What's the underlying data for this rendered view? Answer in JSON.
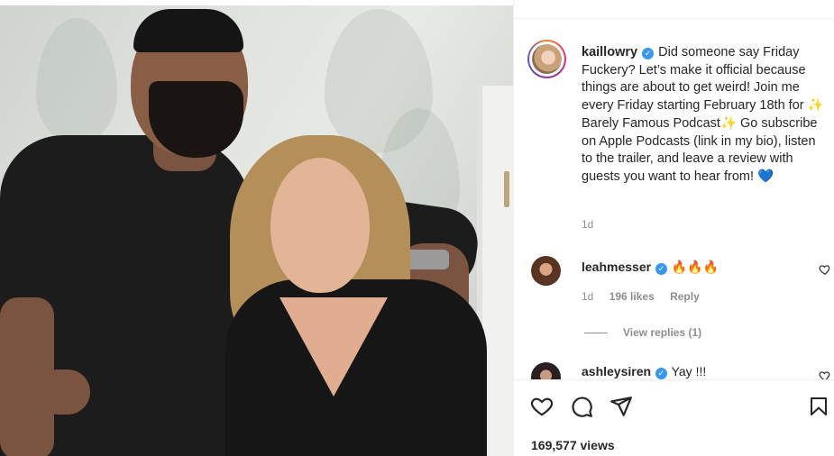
{
  "post": {
    "username": "kaillowry",
    "caption_p1": " Did someone say Friday Fuckery? Let’s make it official because things are about to get weird! Join me every Friday starting February 18th for ",
    "sparkle": "✨",
    "podcast": "Barely Famous Podcast",
    "caption_p2": " Go subscribe on Apple Podcasts (link in my bio), listen to the trailer, and leave a review with guests you want to hear from! ",
    "heart": "💙",
    "time": "1d",
    "views": "169,577 views"
  },
  "comments": [
    {
      "username": "leahmesser",
      "text": "🔥🔥🔥",
      "time": "1d",
      "likes": "196 likes",
      "reply": "Reply"
    },
    {
      "username": "ashleysiren",
      "text": "Yay !!!"
    }
  ],
  "view_replies": "View replies (1)",
  "icons": {
    "verified": "✓",
    "like": "heart-icon",
    "comment": "comment-icon",
    "share": "share-icon",
    "save": "bookmark-icon"
  }
}
